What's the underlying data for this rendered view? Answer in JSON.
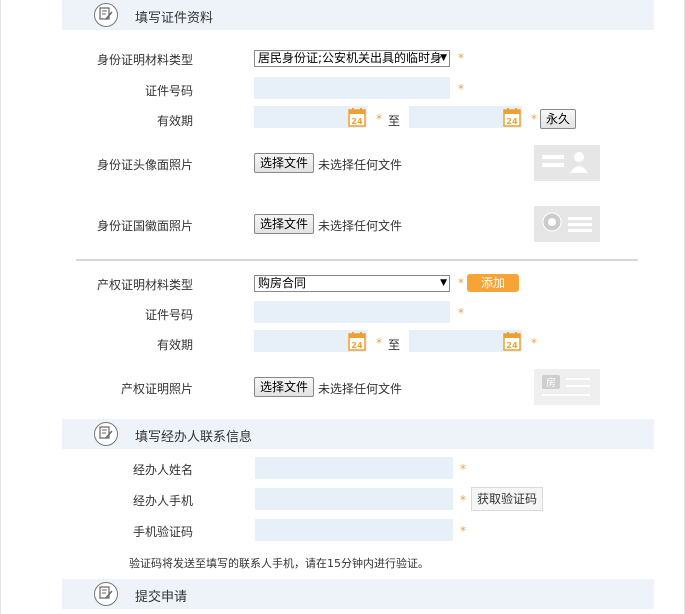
{
  "sections": {
    "id_info": {
      "title": "填写证件资料"
    },
    "agent_info": {
      "title": "填写经办人联系信息"
    },
    "submit": {
      "title": "提交申请"
    }
  },
  "id_form": {
    "material_type_label": "身份证明材料类型",
    "material_type_value": "居民身份证;公安机关出具的临时身",
    "cert_no_label": "证件号码",
    "validity_label": "有效期",
    "to_text": "至",
    "permanent_button": "永久",
    "front_photo_label": "身份证头像面照片",
    "back_photo_label": "身份证国徽面照片"
  },
  "property_form": {
    "material_type_label": "产权证明材料类型",
    "material_type_value": "购房合同",
    "add_button": "添加",
    "cert_no_label": "证件号码",
    "validity_label": "有效期",
    "to_text": "至",
    "photo_label": "产权证明照片",
    "thumb_text": "房"
  },
  "file_input": {
    "button_label": "选择文件",
    "status_text": "未选择任何文件"
  },
  "agent_form": {
    "name_label": "经办人姓名",
    "phone_label": "经办人手机",
    "code_label": "手机验证码",
    "get_code_button": "获取验证码",
    "note": "验证码将发送至填写的联系人手机，请在15分钟内进行验证。"
  },
  "required_mark": "*",
  "calendar_day": "24",
  "colors": {
    "field_bg": "#e7eff9",
    "header_bg": "#eef3f9",
    "required": "#f0a04b",
    "add_button": "#f7a436",
    "calendar": "#f0a030"
  }
}
